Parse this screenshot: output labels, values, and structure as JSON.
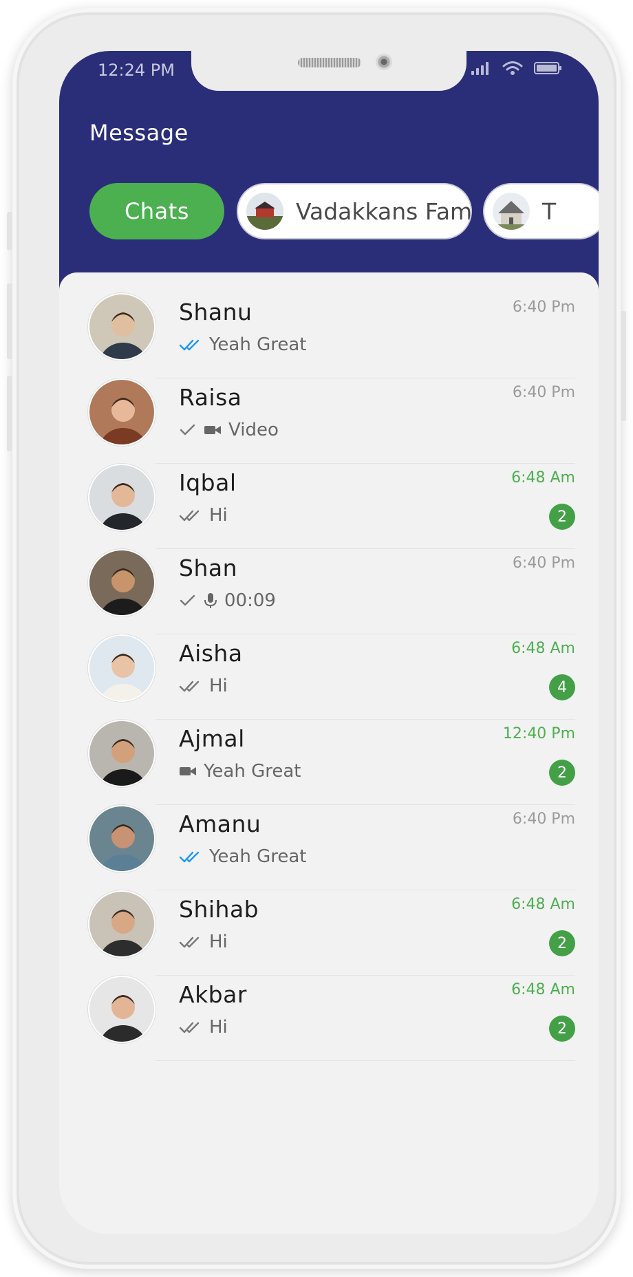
{
  "status_bar": {
    "time": "12:24 PM"
  },
  "header": {
    "title": "Message"
  },
  "filters": [
    {
      "label": "Chats",
      "active": true
    },
    {
      "label": "Vadakkans Fam",
      "active": false
    },
    {
      "label": "T",
      "active": false
    }
  ],
  "chats": [
    {
      "name": "Shanu",
      "time": "6:40 Pm",
      "unread": false,
      "receipt": "double-blue",
      "media": "",
      "message": "Yeah Great",
      "badge": ""
    },
    {
      "name": "Raisa",
      "time": "6:40 Pm",
      "unread": false,
      "receipt": "single-grey",
      "media": "video",
      "message": "Video",
      "badge": ""
    },
    {
      "name": "Iqbal",
      "time": "6:48 Am",
      "unread": true,
      "receipt": "double-grey",
      "media": "",
      "message": "Hi",
      "badge": "2"
    },
    {
      "name": "Shan",
      "time": "6:40 Pm",
      "unread": false,
      "receipt": "single-grey",
      "media": "mic",
      "message": "00:09",
      "badge": ""
    },
    {
      "name": "Aisha",
      "time": "6:48 Am",
      "unread": true,
      "receipt": "double-grey",
      "media": "",
      "message": "Hi",
      "badge": "4"
    },
    {
      "name": "Ajmal",
      "time": "12:40 Pm",
      "unread": true,
      "receipt": "none",
      "media": "video",
      "message": "Yeah Great",
      "badge": "2"
    },
    {
      "name": "Amanu",
      "time": "6:40 Pm",
      "unread": false,
      "receipt": "double-blue",
      "media": "",
      "message": "Yeah Great",
      "badge": ""
    },
    {
      "name": "Shihab",
      "time": "6:48 Am",
      "unread": true,
      "receipt": "double-grey",
      "media": "",
      "message": "Hi",
      "badge": "2"
    },
    {
      "name": "Akbar",
      "time": "6:48 Am",
      "unread": true,
      "receipt": "double-grey",
      "media": "",
      "message": "Hi",
      "badge": "2"
    }
  ],
  "colors": {
    "header_bg": "#2a2e79",
    "accent_green": "#4caf50",
    "badge_green": "#43a047",
    "read_blue": "#2196f3",
    "time_grey": "#9a9a9a"
  }
}
